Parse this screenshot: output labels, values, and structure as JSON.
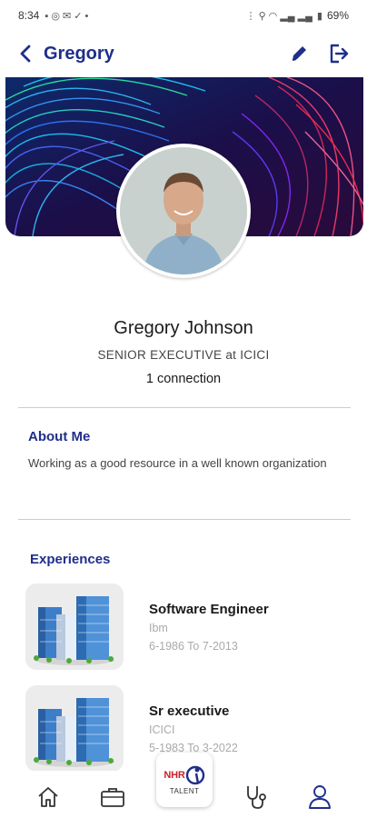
{
  "status_bar": {
    "time": "8:34",
    "battery": "69%"
  },
  "header": {
    "back_icon": "chevron-left-icon",
    "title": "Gregory",
    "edit_icon": "pencil-icon",
    "logout_icon": "logout-icon"
  },
  "profile": {
    "name": "Gregory Johnson",
    "headline": "SENIOR EXECUTIVE  at ICICI",
    "connections": "1 connection"
  },
  "about": {
    "title": "About Me",
    "text": "Working as a good resource in a well known organization"
  },
  "experiences": {
    "title": "Experiences",
    "items": [
      {
        "role": "Software Engineer",
        "company": "Ibm",
        "dates": "6-1986 To 7-2013"
      },
      {
        "role": "Sr executive",
        "company": "ICICI",
        "dates": "5-1983 To 3-2022"
      }
    ]
  },
  "bottom_nav": {
    "items": [
      "home-icon",
      "briefcase-icon",
      "nhrd-talent-logo",
      "stethoscope-icon",
      "user-icon"
    ],
    "logo_text": "NHR",
    "logo_label": "TALENT"
  },
  "colors": {
    "brand_navy": "#1f2f8a",
    "banner_bg": "#1b0f4a",
    "muted_text": "#aaaaaa"
  }
}
